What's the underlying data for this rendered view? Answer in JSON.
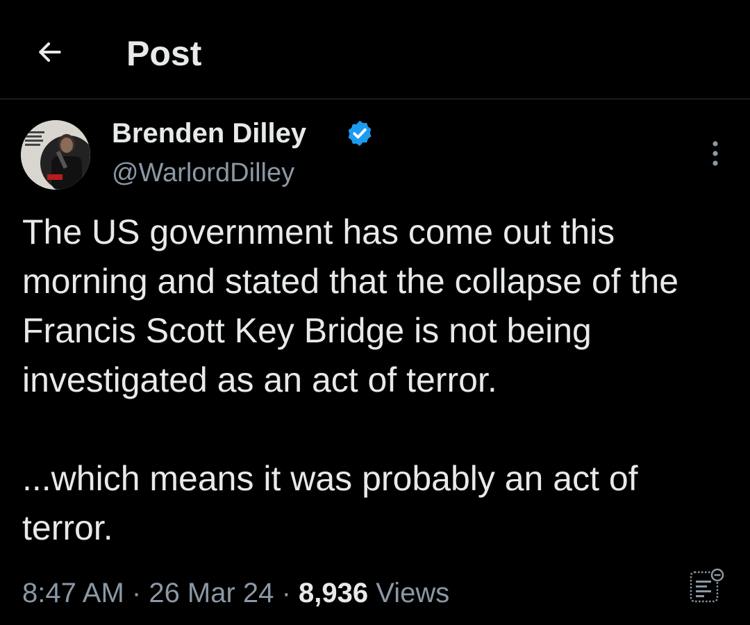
{
  "header": {
    "title": "Post",
    "back_icon": "arrow-left-icon"
  },
  "post": {
    "author": {
      "name": "Brenden Dilley",
      "handle": "@WarlordDilley",
      "verified": true,
      "verified_color": "#1d9bf0",
      "avatar_icon": "profile-photo"
    },
    "text": "The US government has come out this morning and stated that the collapse of the Francis Scott Key Bridge is not being investigated as an act of terror.\n\n...which means it was probably an act of terror.",
    "time": "8:47 AM",
    "date": "26 Mar 24",
    "views_count": "8,936",
    "views_label": "Views",
    "more_icon": "more-vertical-icon",
    "analytics_icon": "analytics-icon"
  },
  "colors": {
    "background": "#000000",
    "primary_text": "#e7e9ea",
    "secondary_text": "#8b98a5",
    "divider": "#2f3336",
    "accent": "#1d9bf0"
  }
}
